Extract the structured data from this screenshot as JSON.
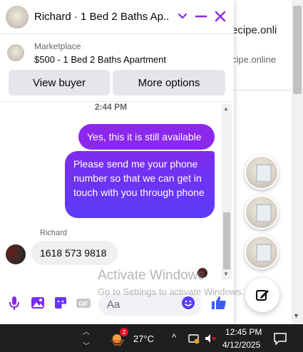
{
  "background_page": {
    "text_line1": "ecipe.onli",
    "text_line2": "cipe.online"
  },
  "chat": {
    "header_title": "Richard · 1 Bed 2 Baths Ap...",
    "marketplace_label": "Marketplace",
    "listing_title": "$500 - 1 Bed 2 Baths Apartment",
    "view_buyer_label": "View buyer",
    "more_options_label": "More options",
    "timestamp": "2:44 PM",
    "messages": [
      {
        "direction": "outgoing",
        "text": "Yes, this it is still available"
      },
      {
        "direction": "outgoing",
        "text": "Please send me your phone number so that we can get in touch with you through phone"
      },
      {
        "direction": "incoming",
        "sender": "Richard",
        "text": "1618 573 9818"
      }
    ],
    "composer_placeholder": "Aa",
    "accent_color": "#8b28ec"
  },
  "watermark": {
    "line1": "Activate Windows",
    "line2": "Go to Settings to activate Windows."
  },
  "taskbar": {
    "weather_badge": "2",
    "temperature": "27°C",
    "time": "12:45 PM",
    "date": "4/12/2025"
  }
}
